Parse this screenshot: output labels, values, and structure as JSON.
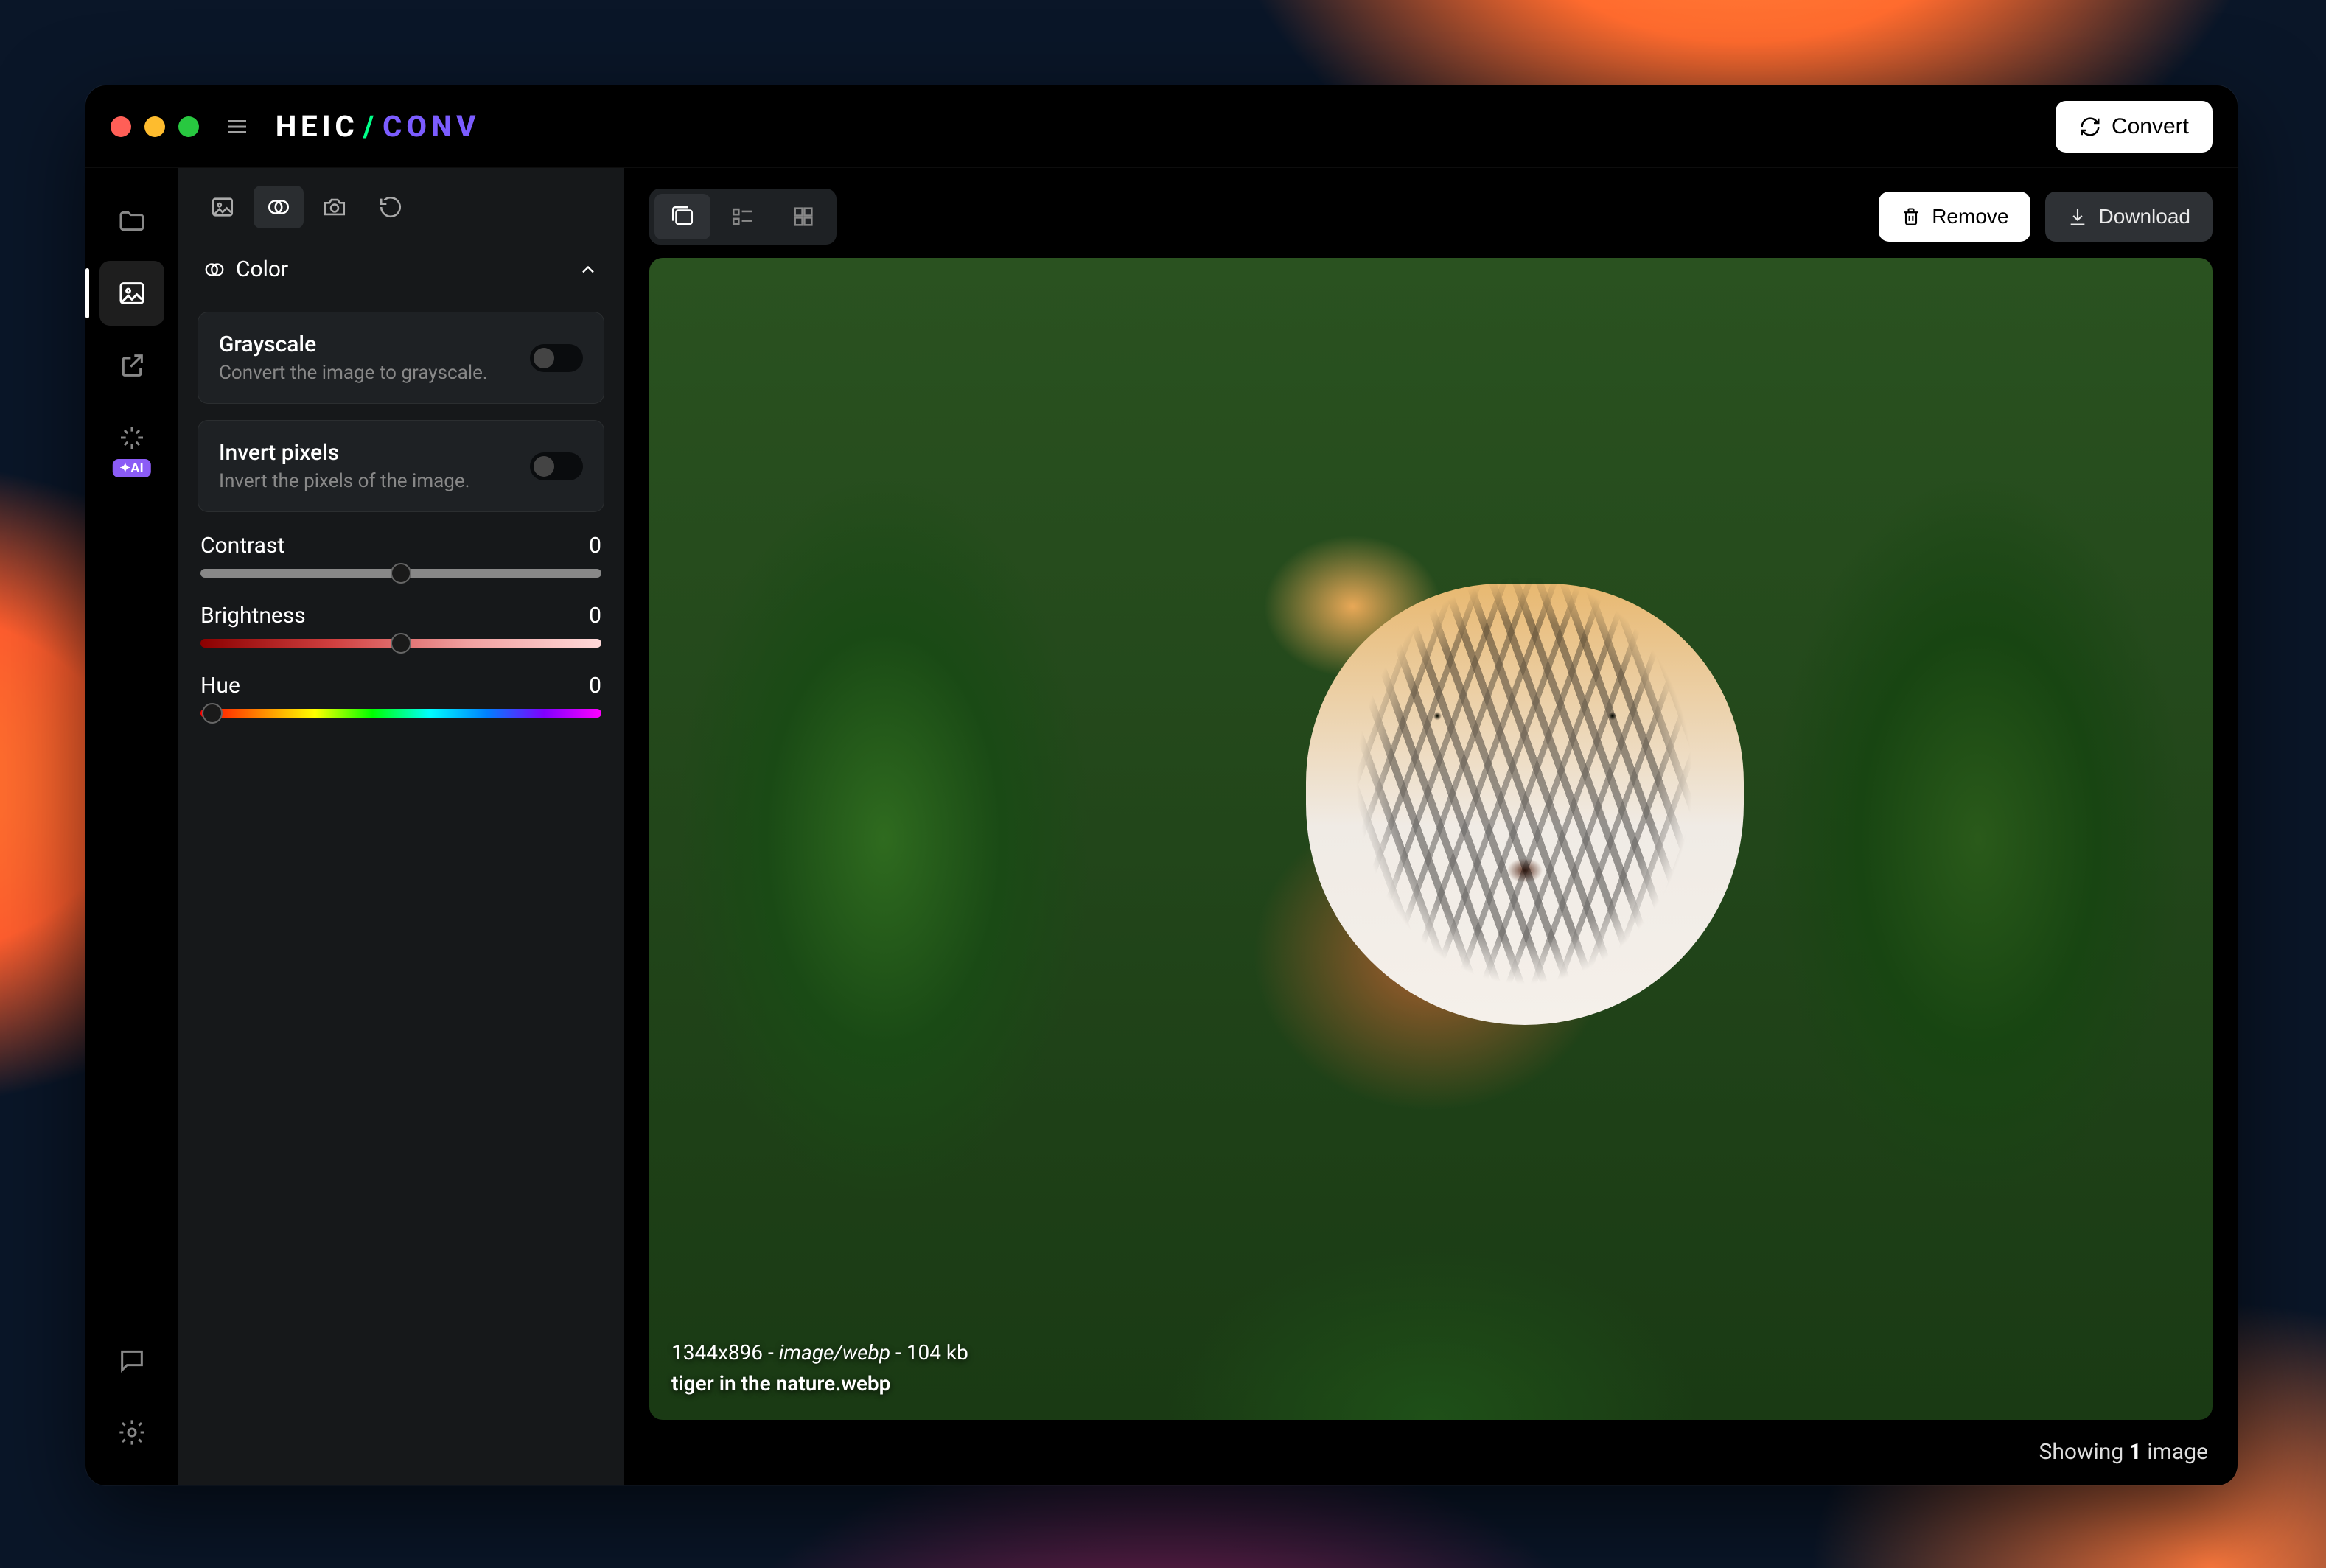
{
  "app": {
    "logo_left": "HEIC",
    "logo_slash": "/",
    "logo_right": "CONV"
  },
  "header": {
    "convert_label": "Convert"
  },
  "rail": {
    "items": [
      {
        "name": "folder"
      },
      {
        "name": "image",
        "active": true
      },
      {
        "name": "external"
      },
      {
        "name": "ai",
        "badge": "✦AI"
      }
    ],
    "bottom": [
      {
        "name": "chat"
      },
      {
        "name": "settings"
      }
    ]
  },
  "panel": {
    "tabs": [
      {
        "name": "image-adjust"
      },
      {
        "name": "overlap",
        "active": true
      },
      {
        "name": "camera"
      },
      {
        "name": "rotate"
      }
    ],
    "section_title": "Color",
    "cards": [
      {
        "title": "Grayscale",
        "desc": "Convert the image to grayscale.",
        "on": false
      },
      {
        "title": "Invert pixels",
        "desc": "Invert the pixels of the image.",
        "on": false
      }
    ],
    "sliders": {
      "contrast_label": "Contrast",
      "contrast_value": "0",
      "brightness_label": "Brightness",
      "brightness_value": "0",
      "hue_label": "Hue",
      "hue_value": "0"
    }
  },
  "main": {
    "remove_label": "Remove",
    "download_label": "Download",
    "image": {
      "dimensions": "1344x896",
      "mime": "image/webp",
      "size": "104 kb",
      "filename": "tiger in the nature.webp"
    },
    "footer_prefix": "Showing ",
    "footer_count": "1",
    "footer_suffix": " image"
  }
}
